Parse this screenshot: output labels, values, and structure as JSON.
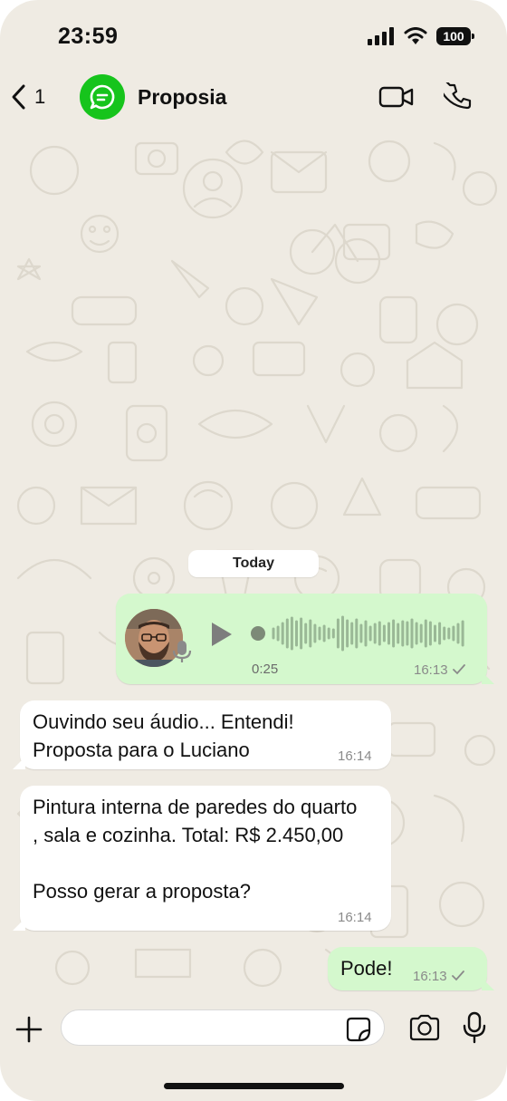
{
  "status_bar": {
    "time": "23:59",
    "battery": "100"
  },
  "header": {
    "back_count": "1",
    "contact_name": "Proposia"
  },
  "chat": {
    "date_label": "Today",
    "messages": [
      {
        "type": "audio",
        "direction": "outgoing",
        "duration": "0:25",
        "time": "16:13",
        "status": "sent"
      },
      {
        "type": "text",
        "direction": "incoming",
        "text": "Ouvindo seu áudio... Entendi!\nProposta para o Luciano",
        "time": "16:14"
      },
      {
        "type": "text",
        "direction": "incoming",
        "text": "Pintura interna de paredes do quarto\n, sala e cozinha. Total: R$ 2.450,00\n\nPosso gerar a proposta?",
        "time": "16:14"
      },
      {
        "type": "text",
        "direction": "outgoing",
        "text": "Pode!",
        "time": "16:13",
        "status": "sent"
      }
    ]
  },
  "composer": {
    "value": "",
    "placeholder": ""
  },
  "icons": {
    "back": "chevron-left-icon",
    "video": "video-camera-icon",
    "call": "phone-icon",
    "plus": "plus-icon",
    "sticker": "sticker-icon",
    "camera": "camera-icon",
    "mic": "microphone-icon"
  },
  "colors": {
    "brand": "#16c41c",
    "outgoing_bubble": "#d4f8cd",
    "incoming_bubble": "#ffffff",
    "background": "#efebe3"
  }
}
